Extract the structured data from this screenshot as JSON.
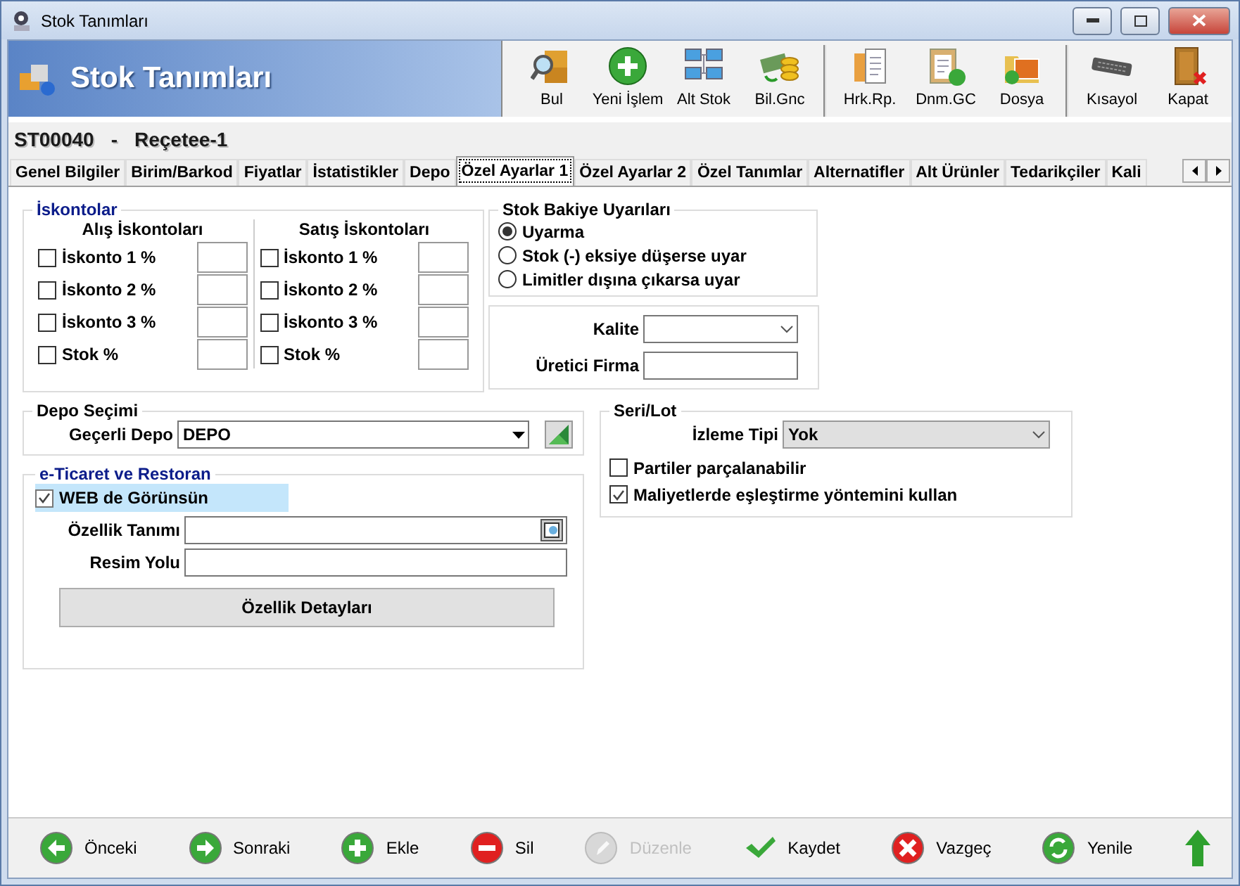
{
  "window": {
    "title": "Stok Tanımları"
  },
  "banner": {
    "title": "Stok Tanımları"
  },
  "toolbar_groups": [
    [
      {
        "label": "Bul",
        "kind": "find"
      },
      {
        "label": "Yeni İşlem",
        "kind": "new"
      },
      {
        "label": "Alt Stok",
        "kind": "monitors"
      },
      {
        "label": "Bil.Gnc",
        "kind": "money"
      }
    ],
    [
      {
        "label": "Hrk.Rp.",
        "kind": "report"
      },
      {
        "label": "Dnm.GC",
        "kind": "clipboard"
      },
      {
        "label": "Dosya",
        "kind": "folder"
      }
    ],
    [
      {
        "label": "Kısayol",
        "kind": "keyboard"
      },
      {
        "label": "Kapat",
        "kind": "door"
      }
    ]
  ],
  "record": {
    "code": "ST00040",
    "separator": "-",
    "name": "Reçetee-1"
  },
  "tabs": [
    {
      "label": "Genel Bilgiler",
      "selected": false
    },
    {
      "label": "Birim/Barkod",
      "selected": false
    },
    {
      "label": "Fiyatlar",
      "selected": false
    },
    {
      "label": "İstatistikler",
      "selected": false
    },
    {
      "label": "Depo",
      "selected": false
    },
    {
      "label": "Özel Ayarlar 1",
      "selected": true
    },
    {
      "label": "Özel Ayarlar 2",
      "selected": false
    },
    {
      "label": "Özel Tanımlar",
      "selected": false
    },
    {
      "label": "Alternatifler",
      "selected": false
    },
    {
      "label": "Alt Ürünler",
      "selected": false
    },
    {
      "label": "Tedarikçiler",
      "selected": false
    },
    {
      "label": "Kali",
      "selected": false
    }
  ],
  "discounts": {
    "title": "İskontolar",
    "columns": [
      {
        "title": "Alış İskontoları",
        "rows": [
          {
            "label": "İskonto 1 %",
            "checked": false
          },
          {
            "label": "İskonto 2 %",
            "checked": false
          },
          {
            "label": "İskonto 3 %",
            "checked": false
          },
          {
            "label": "Stok %",
            "checked": false
          }
        ]
      },
      {
        "title": "Satış İskontoları",
        "rows": [
          {
            "label": "İskonto 1 %",
            "checked": false
          },
          {
            "label": "İskonto 2 %",
            "checked": false
          },
          {
            "label": "İskonto 3 %",
            "checked": false
          },
          {
            "label": "Stok %",
            "checked": false
          }
        ]
      }
    ]
  },
  "stock_warnings": {
    "title": "Stok Bakiye Uyarıları",
    "options": [
      {
        "label": "Uyarma",
        "selected": true
      },
      {
        "label": "Stok (-) eksiye düşerse uyar",
        "selected": false
      },
      {
        "label": "Limitler dışına çıkarsa uyar",
        "selected": false
      }
    ]
  },
  "quality": {
    "fields": [
      {
        "label": "Kalite",
        "kind": "dropdown"
      },
      {
        "label": "Üretici Firma",
        "kind": "text"
      }
    ]
  },
  "warehouse": {
    "title": "Depo Seçimi",
    "label": "Geçerli Depo",
    "value": "DEPO"
  },
  "ecommerce": {
    "title": "e-Ticaret ve Restoran",
    "web": {
      "label": "WEB de Görünsün",
      "checked": true
    },
    "fields": [
      {
        "label": "Özellik Tanımı",
        "kind": "lookup"
      },
      {
        "label": "Resim Yolu",
        "kind": "text"
      }
    ],
    "button": "Özellik Detayları"
  },
  "serial_lot": {
    "title": "Seri/Lot",
    "tracking_label": "İzleme Tipi",
    "tracking_value": "Yok",
    "options": [
      {
        "label": "Partiler parçalanabilir",
        "checked": false
      },
      {
        "label": "Maliyetlerde eşleştirme yöntemini kullan",
        "checked": true
      }
    ]
  },
  "bottom_bar": [
    {
      "label": "Önceki",
      "kind": "prev",
      "disabled": false
    },
    {
      "label": "Sonraki",
      "kind": "next",
      "disabled": false
    },
    {
      "label": "Ekle",
      "kind": "add",
      "disabled": false
    },
    {
      "label": "Sil",
      "kind": "delete",
      "disabled": false
    },
    {
      "label": "Düzenle",
      "kind": "edit",
      "disabled": true
    },
    {
      "label": "Kaydet",
      "kind": "save",
      "disabled": false
    },
    {
      "label": "Vazgeç",
      "kind": "cancel",
      "disabled": false
    },
    {
      "label": "Yenile",
      "kind": "refresh",
      "disabled": false
    },
    {
      "kind": "up",
      "disabled": false
    }
  ]
}
